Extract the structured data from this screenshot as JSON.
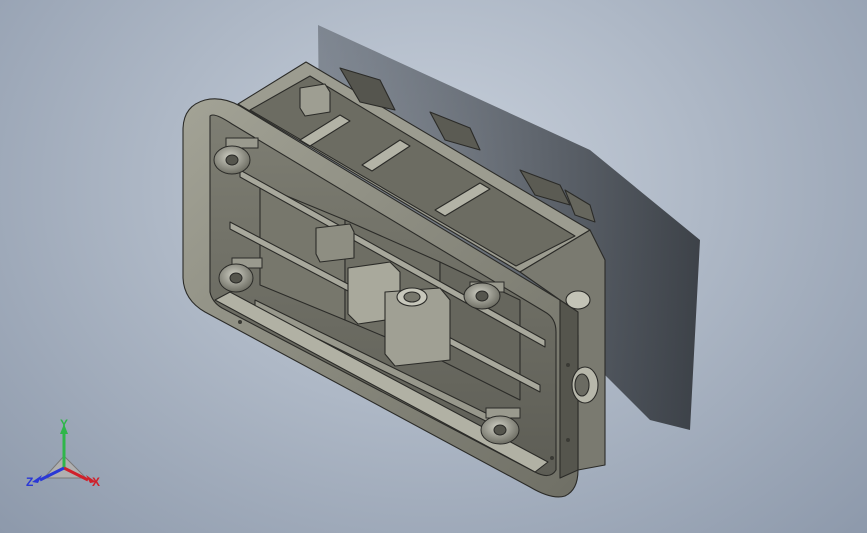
{
  "viewer": {
    "background_top": "#c9d1dc",
    "background_bottom": "#8d99ab",
    "model_color": "#8f8f84",
    "model_edge_color": "#2b2b28",
    "shadow_color": "#3a3f46"
  },
  "triad": {
    "x_label": "X",
    "y_label": "Y",
    "z_label": "Z",
    "x_color": "#d0202a",
    "y_color": "#2fb64a",
    "z_color": "#2a38d6"
  }
}
